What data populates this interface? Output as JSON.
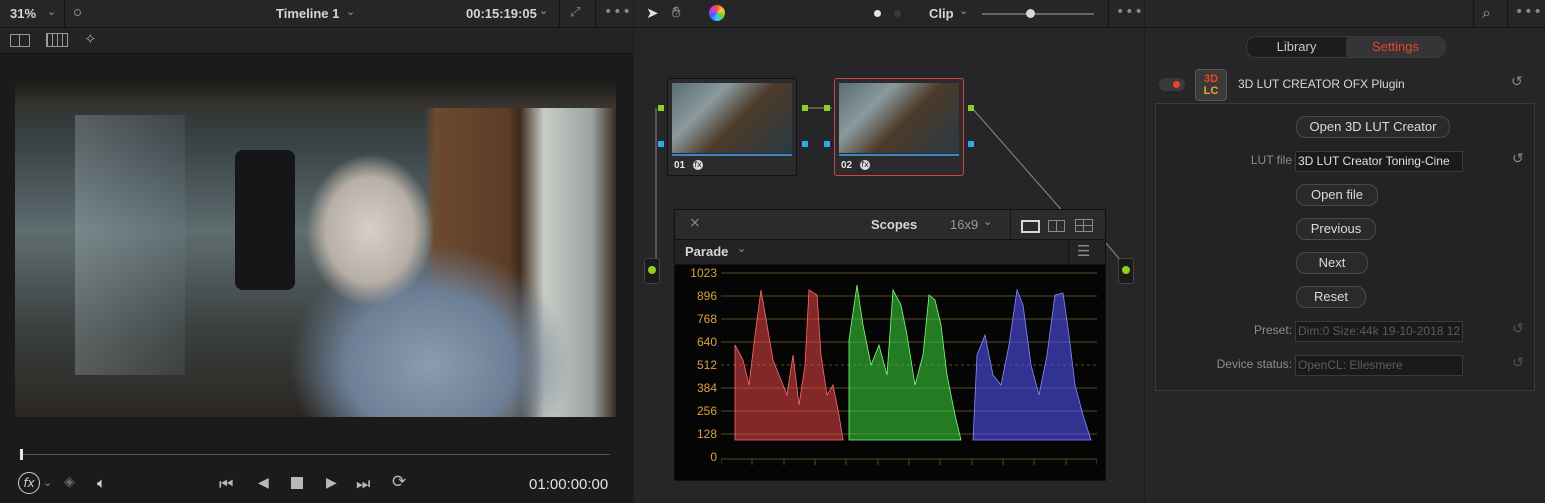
{
  "viewer": {
    "zoom": "31%",
    "timeline_title": "Timeline 1",
    "timecode": "00:15:19:05",
    "playhead_timecode": "01:00:00:00"
  },
  "node_editor": {
    "mode_label": "Clip",
    "nodes": [
      {
        "label": "01"
      },
      {
        "label": "02"
      }
    ]
  },
  "scopes": {
    "title": "Scopes",
    "layout": "16x9",
    "mode": "Parade",
    "y_ticks": [
      "1023",
      "896",
      "768",
      "640",
      "512",
      "384",
      "256",
      "128",
      "0"
    ],
    "tick_color": "#d9a240"
  },
  "inspector": {
    "tabs": [
      {
        "label": "Library",
        "active": false
      },
      {
        "label": "Settings",
        "active": true
      }
    ],
    "plugin_badge_top": "3D",
    "plugin_badge_bottom": "LC",
    "plugin_name": "3D LUT CREATOR OFX Plugin",
    "open_button": "Open 3D LUT Creator",
    "lut_file_label": "LUT file",
    "lut_file_value": "3D LUT Creator Toning-Cine",
    "open_file_button": "Open file",
    "previous_button": "Previous",
    "next_button": "Next",
    "reset_button": "Reset",
    "preset_label": "Preset:",
    "preset_value": "Dim:0 Size:44k 19-10-2018 12",
    "device_status_label": "Device status:",
    "device_status_value": "OpenCL: Ellesmere",
    "accent_color": "#e8452c"
  }
}
